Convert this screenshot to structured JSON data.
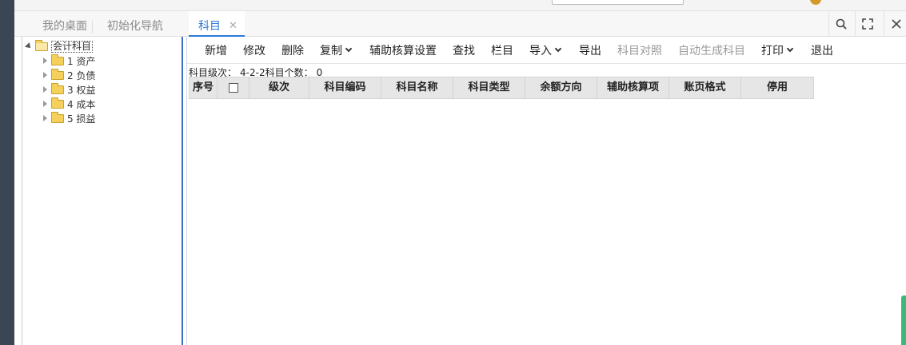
{
  "tabs": [
    {
      "label": "我的桌面",
      "active": false
    },
    {
      "label": "初始化导航",
      "active": false
    },
    {
      "label": "科目",
      "active": true
    }
  ],
  "window_controls": [
    "search-icon",
    "fullscreen-icon",
    "close-icon"
  ],
  "tree": {
    "root": "会计科目",
    "children": [
      "1 资产",
      "2 负债",
      "3 权益",
      "4 成本",
      "5 损益"
    ]
  },
  "toolbar": [
    {
      "label": "新增",
      "enabled": true
    },
    {
      "label": "修改",
      "enabled": true
    },
    {
      "label": "删除",
      "enabled": true
    },
    {
      "label": "复制",
      "enabled": true,
      "dropdown": true
    },
    {
      "label": "辅助核算设置",
      "enabled": true
    },
    {
      "label": "查找",
      "enabled": true
    },
    {
      "label": "栏目",
      "enabled": true
    },
    {
      "label": "导入",
      "enabled": true,
      "dropdown": true
    },
    {
      "label": "导出",
      "enabled": true
    },
    {
      "label": "科目对照",
      "enabled": false
    },
    {
      "label": "自动生成科目",
      "enabled": false
    },
    {
      "label": "打印",
      "enabled": true,
      "dropdown": true
    },
    {
      "label": "退出",
      "enabled": true
    }
  ],
  "info": {
    "level_label": "科目级次：",
    "level_value": "4-2-2",
    "count_label": "科目个数：",
    "count_value": "0"
  },
  "grid": {
    "columns": [
      "序号",
      "",
      "级次",
      "科目编码",
      "科目名称",
      "科目类型",
      "余额方向",
      "辅助核算项",
      "账页格式",
      "停用"
    ]
  },
  "colors": {
    "accent": "#2d7ad9",
    "sidebar": "#3a4654",
    "splitter": "#3d6cc0"
  }
}
